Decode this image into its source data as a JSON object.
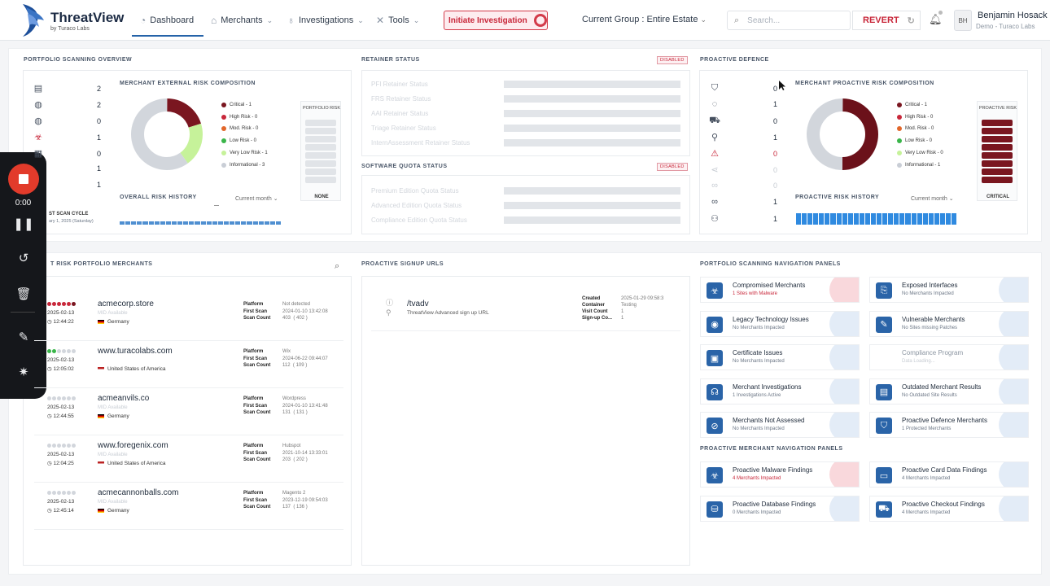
{
  "header": {
    "brand": "ThreatView",
    "brand_sub": "by Turaco Labs",
    "nav": [
      {
        "label": "Dashboard",
        "icon": "gauge-icon"
      },
      {
        "label": "Merchants",
        "icon": "store-icon"
      },
      {
        "label": "Investigations",
        "icon": "stethoscope-icon"
      },
      {
        "label": "Tools",
        "icon": "tools-icon"
      }
    ],
    "initiate_label": "Initiate Investigation",
    "group_label": "Current Group : Entire Estate",
    "search_placeholder": "Search...",
    "revert_label": "REVERT",
    "avatar_initials": "BH",
    "user_name": "Benjamin Hosack",
    "user_org": "Demo - Turaco Labs"
  },
  "portfolio_overview": {
    "title": "PORTFOLIO SCANNING OVERVIEW",
    "counts": [
      {
        "icon": "building-icon",
        "value": "2"
      },
      {
        "icon": "globe-icon",
        "value": "2"
      },
      {
        "icon": "globe-lock-icon",
        "value": "0"
      },
      {
        "icon": "biohazard-icon",
        "value": "1"
      },
      {
        "icon": "calendar-icon",
        "value": "0"
      },
      {
        "icon": "item-icon",
        "value": "1"
      },
      {
        "icon": "item-icon",
        "value": "1"
      }
    ],
    "composition_title": "MERCHANT EXTERNAL RISK COMPOSITION",
    "legend": [
      {
        "label": "Critical - 1",
        "color": "#7a1620"
      },
      {
        "label": "High Risk - 0",
        "color": "#c8273a"
      },
      {
        "label": "Mod. Risk - 0",
        "color": "#e2672a"
      },
      {
        "label": "Low Risk - 0",
        "color": "#3ab54a"
      },
      {
        "label": "Very Low Risk - 1",
        "color": "#c6f29a"
      },
      {
        "label": "Informational - 3",
        "color": "#c9ced6"
      }
    ],
    "donut": [
      {
        "value": 1,
        "color": "#7a1620"
      },
      {
        "value": 1,
        "color": "#c6f29a"
      },
      {
        "value": 3,
        "color": "#d2d6dc"
      }
    ],
    "portfolio_risk_label": "PORTFOLIO RISK",
    "portfolio_risk_value": "NONE",
    "history_title": "OVERALL RISK HISTORY",
    "history_period": "Current month",
    "last_scan_label": "ST SCAN CYCLE",
    "last_scan_date": "ary 1, 2025 (Saturday)"
  },
  "retainer": {
    "title": "RETAINER STATUS",
    "badge": "DISABLED",
    "items": [
      "PFI Retainer Status",
      "FRS Retainer Status",
      "AAI Retainer Status",
      "Triage Retainer Status",
      "InternAssessment Retainer Status"
    ]
  },
  "quota": {
    "title": "SOFTWARE QUOTA STATUS",
    "badge": "DISABLED",
    "items": [
      "Premium Edition Quota Status",
      "Advanced Edition Quota Status",
      "Compliance Edition Quota Status"
    ]
  },
  "proactive": {
    "title": "PROACTIVE DEFENCE",
    "counts": [
      {
        "icon": "shield-icon",
        "value": "0"
      },
      {
        "icon": "chat-shield-icon",
        "value": "1"
      },
      {
        "icon": "cart-icon",
        "value": "0"
      },
      {
        "icon": "bug-icon",
        "value": "1"
      },
      {
        "icon": "warning-icon",
        "value": "0"
      },
      {
        "icon": "share-icon",
        "value": "0"
      },
      {
        "icon": "link-faded-icon",
        "value": "0"
      },
      {
        "icon": "link-icon",
        "value": "1"
      },
      {
        "icon": "user-icon",
        "value": "1"
      }
    ],
    "composition_title": "MERCHANT PROACTIVE RISK COMPOSITION",
    "legend": [
      {
        "label": "Critical - 1",
        "color": "#7a1620"
      },
      {
        "label": "High Risk - 0",
        "color": "#c8273a"
      },
      {
        "label": "Mod. Risk - 0",
        "color": "#e2672a"
      },
      {
        "label": "Low Risk - 0",
        "color": "#3ab54a"
      },
      {
        "label": "Very Low Risk - 0",
        "color": "#c6f29a"
      },
      {
        "label": "Informational - 1",
        "color": "#c9ced6"
      }
    ],
    "donut": [
      {
        "value": 1,
        "color": "#6b111a"
      },
      {
        "value": 1,
        "color": "#d2d6dc"
      }
    ],
    "risk_label": "PROACTIVE RISK",
    "risk_value": "CRITICAL",
    "history_title": "PROACTIVE RISK HISTORY",
    "history_period": "Current month"
  },
  "merchants_section": {
    "title": "T RISK PORTFOLIO MERCHANTS",
    "kv_labels": "Platform\nFirst Scan\nScan Count",
    "items": [
      {
        "dots": [
          "#c8273a",
          "#c8273a",
          "#c8273a",
          "#c8273a",
          "#c8273a",
          "#7a1620"
        ],
        "date": "2025-02-13",
        "time": "12:44:22",
        "name": "acmecorp.store",
        "sub": "MID Available",
        "country": "Germany",
        "flag": "de",
        "vals": "Not detected\n2024-01-10 13:42:08\n403  ( 402 )"
      },
      {
        "dots": [
          "#3ab54a",
          "#3ab54a",
          "#d2d6dc",
          "#d2d6dc",
          "#d2d6dc",
          "#d2d6dc"
        ],
        "date": "2025-02-13",
        "time": "12:05:02",
        "name": "www.turacolabs.com",
        "sub": "",
        "country": "United States of America",
        "flag": "us",
        "vals": "Wix\n2024-06-22 09:44:07\n112  ( 109 )"
      },
      {
        "dots": [
          "#d2d6dc",
          "#d2d6dc",
          "#d2d6dc",
          "#d2d6dc",
          "#d2d6dc",
          "#d2d6dc"
        ],
        "date": "2025-02-13",
        "time": "12:44:55",
        "name": "acmeanvils.co",
        "sub": "MID Available",
        "country": "Germany",
        "flag": "de",
        "vals": "Wordpress\n2024-01-10 13:41:48\n131  ( 131 )"
      },
      {
        "dots": [
          "#d2d6dc",
          "#d2d6dc",
          "#d2d6dc",
          "#d2d6dc",
          "#d2d6dc",
          "#d2d6dc"
        ],
        "date": "2025-02-13",
        "time": "12:04:25",
        "name": "www.foregenix.com",
        "sub": "MID Available",
        "country": "United States of America",
        "flag": "us",
        "vals": "Hubspot\n2021-10-14 13:33:01\n203  ( 202 )"
      },
      {
        "dots": [
          "#d2d6dc",
          "#d2d6dc",
          "#d2d6dc",
          "#d2d6dc",
          "#d2d6dc",
          "#d2d6dc"
        ],
        "date": "2025-02-13",
        "time": "12:45:14",
        "name": "acmecannonballs.com",
        "sub": "MID Available",
        "country": "Germany",
        "flag": "de",
        "vals": "Magento 2\n2023-12-19 09:54:03\n137  ( 136 )"
      }
    ]
  },
  "signup": {
    "title": "PROACTIVE SIGNUP URLS",
    "url": "/tvadv",
    "desc": "ThreatView Advanced sign up URL",
    "kv_labels": "Created\nContainer\nVisit Count\nSign-up Co...",
    "kv_vals": "2025-01-29 09:58:3\nTesting\n1\n1"
  },
  "nav_panels": {
    "title": "PORTFOLIO SCANNING NAVIGATION PANELS",
    "items": [
      {
        "icon": "biohazard-icon",
        "title": "Compromised Merchants",
        "sub": "1 Sites with Malware",
        "alert": true
      },
      {
        "icon": "interfaces-icon",
        "title": "Exposed Interfaces",
        "sub": "No Merchants Impacted",
        "alert": false
      },
      {
        "icon": "legacy-icon",
        "title": "Legacy Technology Issues",
        "sub": "No Merchants Impacted",
        "alert": false
      },
      {
        "icon": "vulnerable-icon",
        "title": "Vulnerable Merchants",
        "sub": "No Sites missing Patches",
        "alert": false
      },
      {
        "icon": "certificate-icon",
        "title": "Certificate Issues",
        "sub": "No Merchants Impacted",
        "alert": false
      },
      {
        "icon": "compliance-icon",
        "title": "Compliance Program",
        "sub": "Data Loading...",
        "alert": false,
        "faded": true
      },
      {
        "icon": "investigation-icon",
        "title": "Merchant Investigations",
        "sub": "1 Investigations Active",
        "alert": false
      },
      {
        "icon": "outdated-icon",
        "title": "Outdated Merchant Results",
        "sub": "No Outdated Site Results",
        "alert": false
      },
      {
        "icon": "eye-off-icon",
        "title": "Merchants Not Assessed",
        "sub": "No Merchants Impacted",
        "alert": false
      },
      {
        "icon": "shield-star-icon",
        "title": "Proactive Defence Merchants",
        "sub": "1 Protected Merchants",
        "alert": false
      }
    ]
  },
  "proactive_panels": {
    "title": "PROACTIVE MERCHANT NAVIGATION PANELS",
    "items": [
      {
        "icon": "biohazard-icon",
        "title": "Proactive Malware Findings",
        "sub": "4 Merchants Impacted",
        "alert": true
      },
      {
        "icon": "card-icon",
        "title": "Proactive Card Data Findings",
        "sub": "4 Merchants Impacted",
        "alert": false
      },
      {
        "icon": "database-icon",
        "title": "Proactive Database Findings",
        "sub": "0 Merchants Impacted",
        "alert": false
      },
      {
        "icon": "cart-icon",
        "title": "Proactive Checkout Findings",
        "sub": "4 Merchants Impacted",
        "alert": false
      }
    ]
  },
  "recorder": {
    "time": "0:00"
  }
}
